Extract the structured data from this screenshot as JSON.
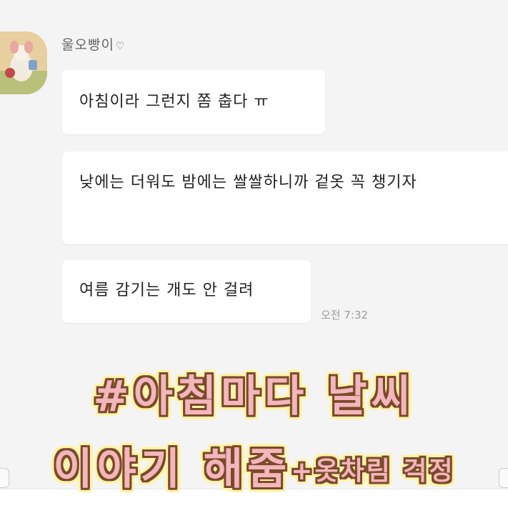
{
  "chat": {
    "sender_name": "울오빵이",
    "sender_heart": "♡",
    "messages": [
      {
        "text": "아침이라 그런지 쫌 춥다 ㅠ"
      },
      {
        "text": "낮에는 더워도 밤에는 쌀쌀하니까 겉옷 꼭 챙기자"
      },
      {
        "text": "여름 감기는 개도 안 걸려"
      }
    ],
    "timestamp": "오전 7:32"
  },
  "overlay": {
    "line1": "#아침마다 날씨",
    "line2_main": "이야기 해줌",
    "line2_small": "+옷차림 걱정"
  },
  "colors": {
    "background": "#f4f4f5",
    "bubble": "#ffffff",
    "overlay_fill": "#f3b6bc",
    "overlay_outline": "#7a4a2a",
    "overlay_glow": "#fff3a8"
  }
}
